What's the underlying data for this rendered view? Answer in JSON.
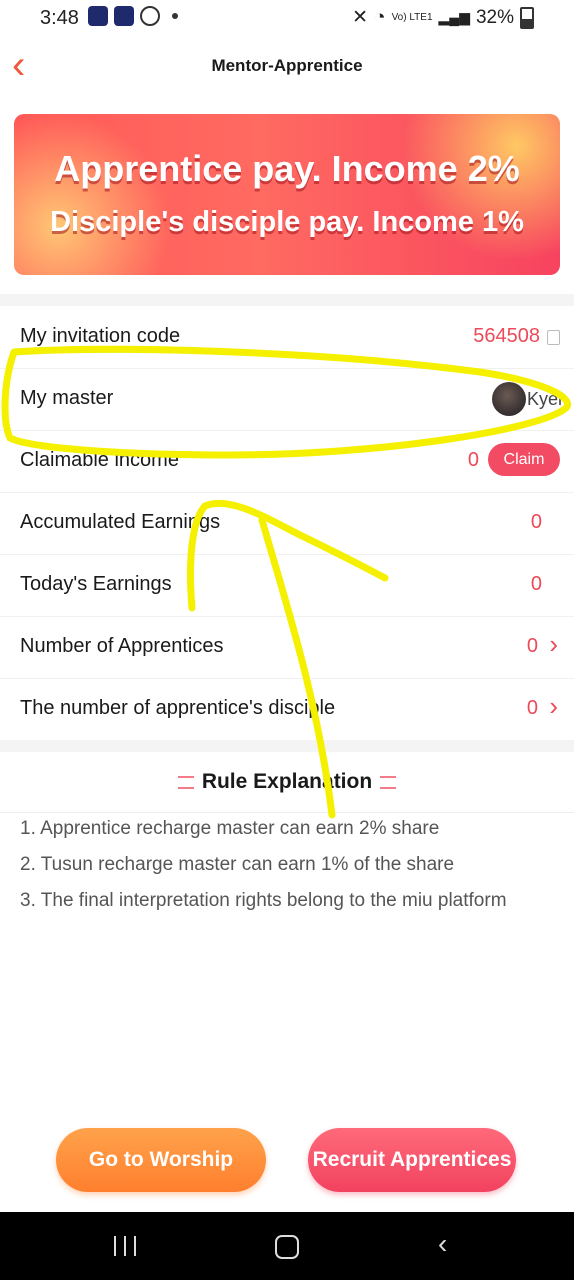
{
  "status": {
    "time": "3:48",
    "network_label": "Vo) LTE1",
    "battery": "32%"
  },
  "header": {
    "title": "Mentor-Apprentice",
    "back_glyph": "‹"
  },
  "banner": {
    "line1": "Apprentice pay. Income 2%",
    "line2": "Disciple's disciple pay. Income 1%"
  },
  "rows": {
    "invitation_label": "My invitation code",
    "invitation_code": "564508",
    "master_label": "My master",
    "master_name": "Kyel",
    "claimable_label": "Claimable income",
    "claimable_value": "0",
    "claim_button": "Claim",
    "accumulated_label": "Accumulated Earnings",
    "accumulated_value": "0",
    "today_label": "Today's Earnings",
    "today_value": "0",
    "apprentices_label": "Number of Apprentices",
    "apprentices_value": "0",
    "disciples_label": "The number of apprentice's disciple",
    "disciples_value": "0"
  },
  "rules": {
    "title": "Rule Explanation",
    "items": [
      "1. Apprentice recharge master can earn 2% share",
      "2. Tusun recharge master can earn 1% of the share",
      "3. The final interpretation rights belong to the miu platform"
    ]
  },
  "buttons": {
    "worship": "Go to Worship",
    "recruit": "Recruit Apprentices"
  },
  "colors": {
    "accent": "#ec4a58",
    "worship": "#ff8a36",
    "recruit": "#f2425f",
    "highlight": "#f5f000"
  },
  "icons": [
    "back-chevron-icon",
    "copy-icon",
    "chevron-right-icon",
    "avatar",
    "recent-apps-icon",
    "home-icon",
    "back-icon"
  ]
}
